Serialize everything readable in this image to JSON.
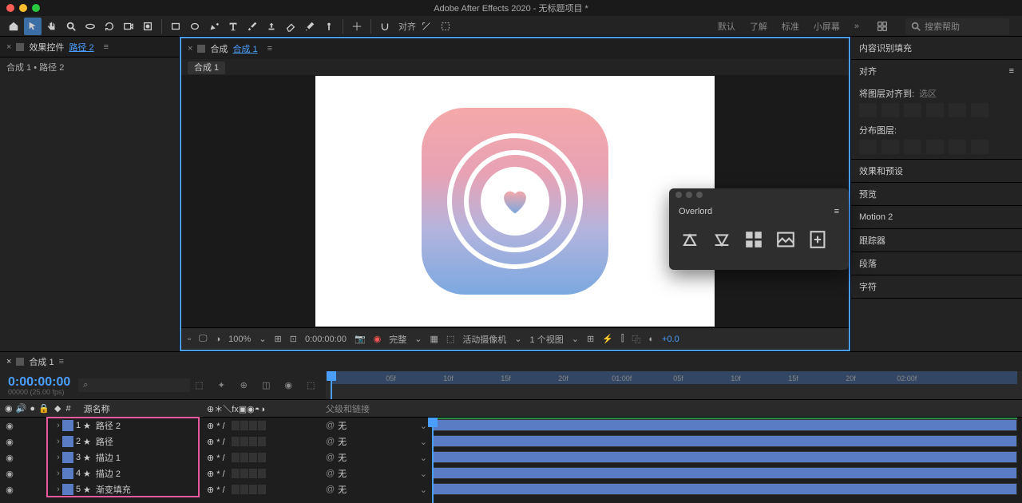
{
  "app": {
    "title": "Adobe After Effects 2020 - 无标题项目 *"
  },
  "workspace_tabs": [
    "默认",
    "了解",
    "标准",
    "小屏幕"
  ],
  "search_help_placeholder": "搜索帮助",
  "effect_controls": {
    "label": "效果控件",
    "target": "路径 2",
    "breadcrumb": "合成 1 • 路径 2"
  },
  "composition_panel": {
    "label": "合成",
    "target": "合成 1",
    "tab": "合成 1"
  },
  "viewer_footer": {
    "zoom": "100%",
    "timecode": "0:00:00:00",
    "quality": "完整",
    "camera": "活动摄像机",
    "views": "1 个视图",
    "exposure": "+0.0"
  },
  "right_panels": {
    "content_aware": "内容识别填充",
    "align": {
      "title": "对齐",
      "align_to_label": "将图层对齐到:",
      "align_to_value": "选区",
      "distribute_label": "分布图层:"
    },
    "effects_presets": "效果和预设",
    "preview": "预览",
    "motion2": "Motion 2",
    "tracker": "跟踪器",
    "paragraph": "段落",
    "character": "字符"
  },
  "overlord": {
    "title": "Overlord"
  },
  "timeline": {
    "tab": "合成 1",
    "timecode": "0:00:00:00",
    "frame_info": "00000 (25.00 fps)",
    "search_placeholder": "⌕",
    "columns": {
      "source_name": "源名称",
      "parent": "父级和链接"
    },
    "layers": [
      {
        "num": 1,
        "name": "路径 2",
        "switches": "⊕ * /",
        "parent": "无"
      },
      {
        "num": 2,
        "name": "路径",
        "switches": "⊕ * /",
        "parent": "无"
      },
      {
        "num": 3,
        "name": "描边 1",
        "switches": "⊕ * /",
        "parent": "无"
      },
      {
        "num": 4,
        "name": "描边 2",
        "switches": "⊕ * /",
        "parent": "无"
      },
      {
        "num": 5,
        "name": "渐变填充",
        "switches": "⊕ * /",
        "parent": "无"
      }
    ],
    "ruler_ticks": [
      "05f",
      "10f",
      "15f",
      "20f",
      "01:00f",
      "05f",
      "10f",
      "15f",
      "20f",
      "02:00f"
    ]
  }
}
